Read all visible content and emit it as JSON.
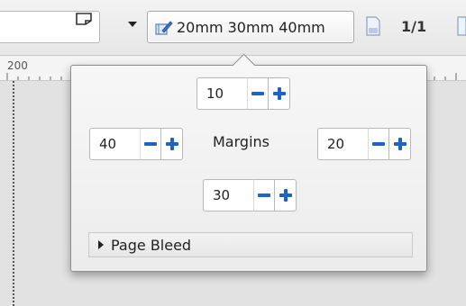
{
  "toolbar": {
    "margins_button_label": "20mm 30mm 40mm",
    "page_count": "1/1",
    "icons": [
      "page-layout-icon",
      "dropdown-arrow-icon",
      "margins-edit-icon",
      "document-icon"
    ]
  },
  "ruler": {
    "first_label": "200"
  },
  "popover": {
    "top_margin": "10",
    "left_margin": "40",
    "right_margin": "20",
    "bottom_margin": "30",
    "center_label": "Margins",
    "bleed_label": "Page Bleed"
  },
  "colors": {
    "accent": "#1f63c6"
  }
}
